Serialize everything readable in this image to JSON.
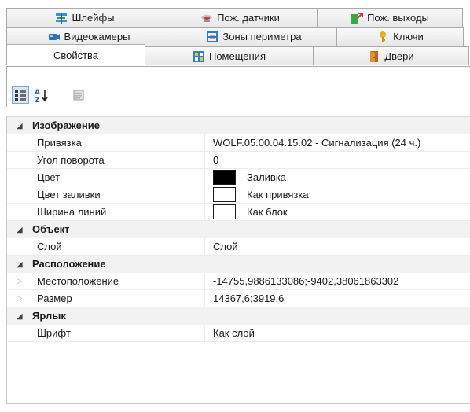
{
  "tabs": {
    "row1": [
      {
        "label": "Шлейфы",
        "icon": "loops-icon"
      },
      {
        "label": "Пож. датчики",
        "icon": "fire-sensor-icon"
      },
      {
        "label": "Пож. выходы",
        "icon": "fire-exit-icon"
      }
    ],
    "row2": [
      {
        "label": "Видеокамеры",
        "icon": "camera-icon"
      },
      {
        "label": "Зоны периметра",
        "icon": "perimeter-icon"
      },
      {
        "label": "Ключи",
        "icon": "key-icon"
      }
    ],
    "row3": [
      {
        "label": "Свойства",
        "icon": ""
      },
      {
        "label": "Помещения",
        "icon": "rooms-icon"
      },
      {
        "label": "Двери",
        "icon": "door-icon"
      }
    ]
  },
  "toolbar": {
    "categorized_icon": "categorized-icon",
    "alphabetical_icon": "sort-az-icon",
    "property_pages_icon": "property-pages-icon"
  },
  "grid": {
    "image": {
      "title": "Изображение",
      "binding_label": "Привязка",
      "binding_value": "WOLF.05.00.04.15.02 - Сигнализация (24 ч.)",
      "rotation_label": "Угол поворота",
      "rotation_value": "0",
      "color_label": "Цвет",
      "color_value": "Заливка",
      "fill_color_label": "Цвет заливки",
      "fill_color_value": "Как привязка",
      "line_width_label": "Ширина линий",
      "line_width_value": "Как блок"
    },
    "object": {
      "title": "Объект",
      "layer_label": "Слой",
      "layer_value": "Слой"
    },
    "location": {
      "title": "Расположение",
      "position_label": "Местоположение",
      "position_value": "-14755,9886133086;-9402,38061863302",
      "size_label": "Размер",
      "size_value": "14367,6;3919,6"
    },
    "label": {
      "title": "Ярлык",
      "font_label": "Шрифт",
      "font_value": "Как слой"
    }
  },
  "colors": {
    "color_swatch": "#000000",
    "fill_swatch": "#ffffff",
    "line_swatch": "#ffffff"
  }
}
